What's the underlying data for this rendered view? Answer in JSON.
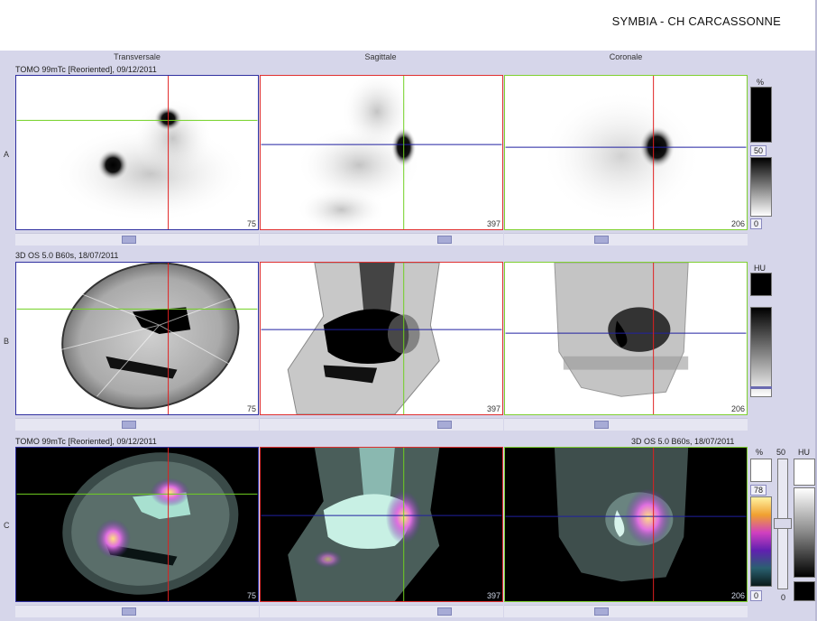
{
  "header": {
    "title": "SYMBIA - CH CARCASSONNE"
  },
  "columns": [
    "Transversale",
    "Sagittale",
    "Coronale"
  ],
  "rows": [
    {
      "letter": "A",
      "series_left": "TOMO 99mTc [Reoriented], 09/12/2011",
      "series_right": ""
    },
    {
      "letter": "B",
      "series_left": "3D  OS  5.0  B60s, 18/07/2011",
      "series_right": ""
    },
    {
      "letter": "C",
      "series_left": "TOMO 99mTc [Reoriented], 09/12/2011",
      "series_right": "3D  OS  5.0  B60s, 18/07/2011"
    }
  ],
  "slice_numbers": {
    "transversale": "75",
    "sagittale": "397",
    "coronale": "206"
  },
  "colorbars": {
    "A": {
      "unit": "%",
      "value_mid": "50",
      "value_min": "0"
    },
    "B": {
      "unit": "HU"
    },
    "C": {
      "unit": "%",
      "value_top": "78",
      "value_min": "0",
      "fusion_label": "50",
      "ct_unit": "HU",
      "ct_min": "0"
    }
  },
  "colors": {
    "sagittal_border": "#e03030",
    "coronal_border": "#7fd030",
    "transverse_border": "#3030a0",
    "crosshair_red": "#e02020",
    "crosshair_green": "#6fd020",
    "crosshair_blue": "#2020a0"
  }
}
